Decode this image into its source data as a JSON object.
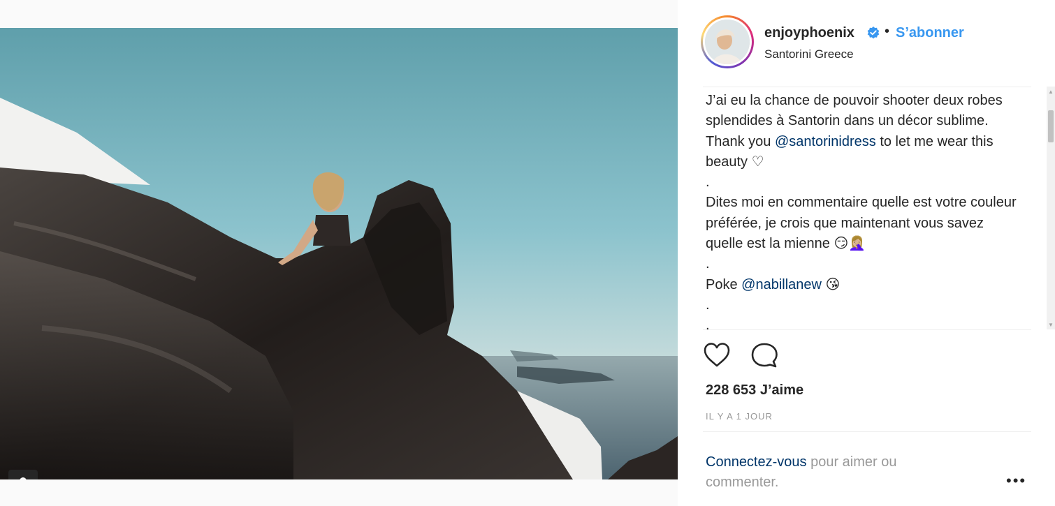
{
  "post": {
    "username": "enjoyphoenix",
    "follow_label": "S’abonner",
    "separator": "•",
    "location": "Santorini Greece",
    "caption": {
      "line1_a": "J’ai eu la chance de pouvoir shooter deux robes splendides à Santorin dans un décor sublime. Thank you ",
      "mention1": "@santorinidress",
      "line1_b": " to let me wear this beauty ♡",
      "dot1": ".",
      "line2": "Dites moi en commentaire quelle est votre couleur préférée, je crois que maintenant vous savez quelle est la mienne 😏🤦🏼‍♀️",
      "dot2": ".",
      "poke": "Poke ",
      "mention2": "@nabillanew",
      "poke_emoji": " 😘",
      "dot3": ".",
      "dot4": "."
    },
    "likes": "228 653 J’aime",
    "time": "IL Y A 1 JOUR",
    "login_link": "Connectez-vous",
    "login_rest": " pour aimer ou commenter.",
    "more": "•••"
  },
  "icons": [
    "heart-icon",
    "comment-icon",
    "verified-icon",
    "user-tag-icon",
    "more-options-icon"
  ],
  "colors": {
    "accent": "#3897f0",
    "text": "#262626",
    "muted": "#999999",
    "mention": "#003569"
  }
}
